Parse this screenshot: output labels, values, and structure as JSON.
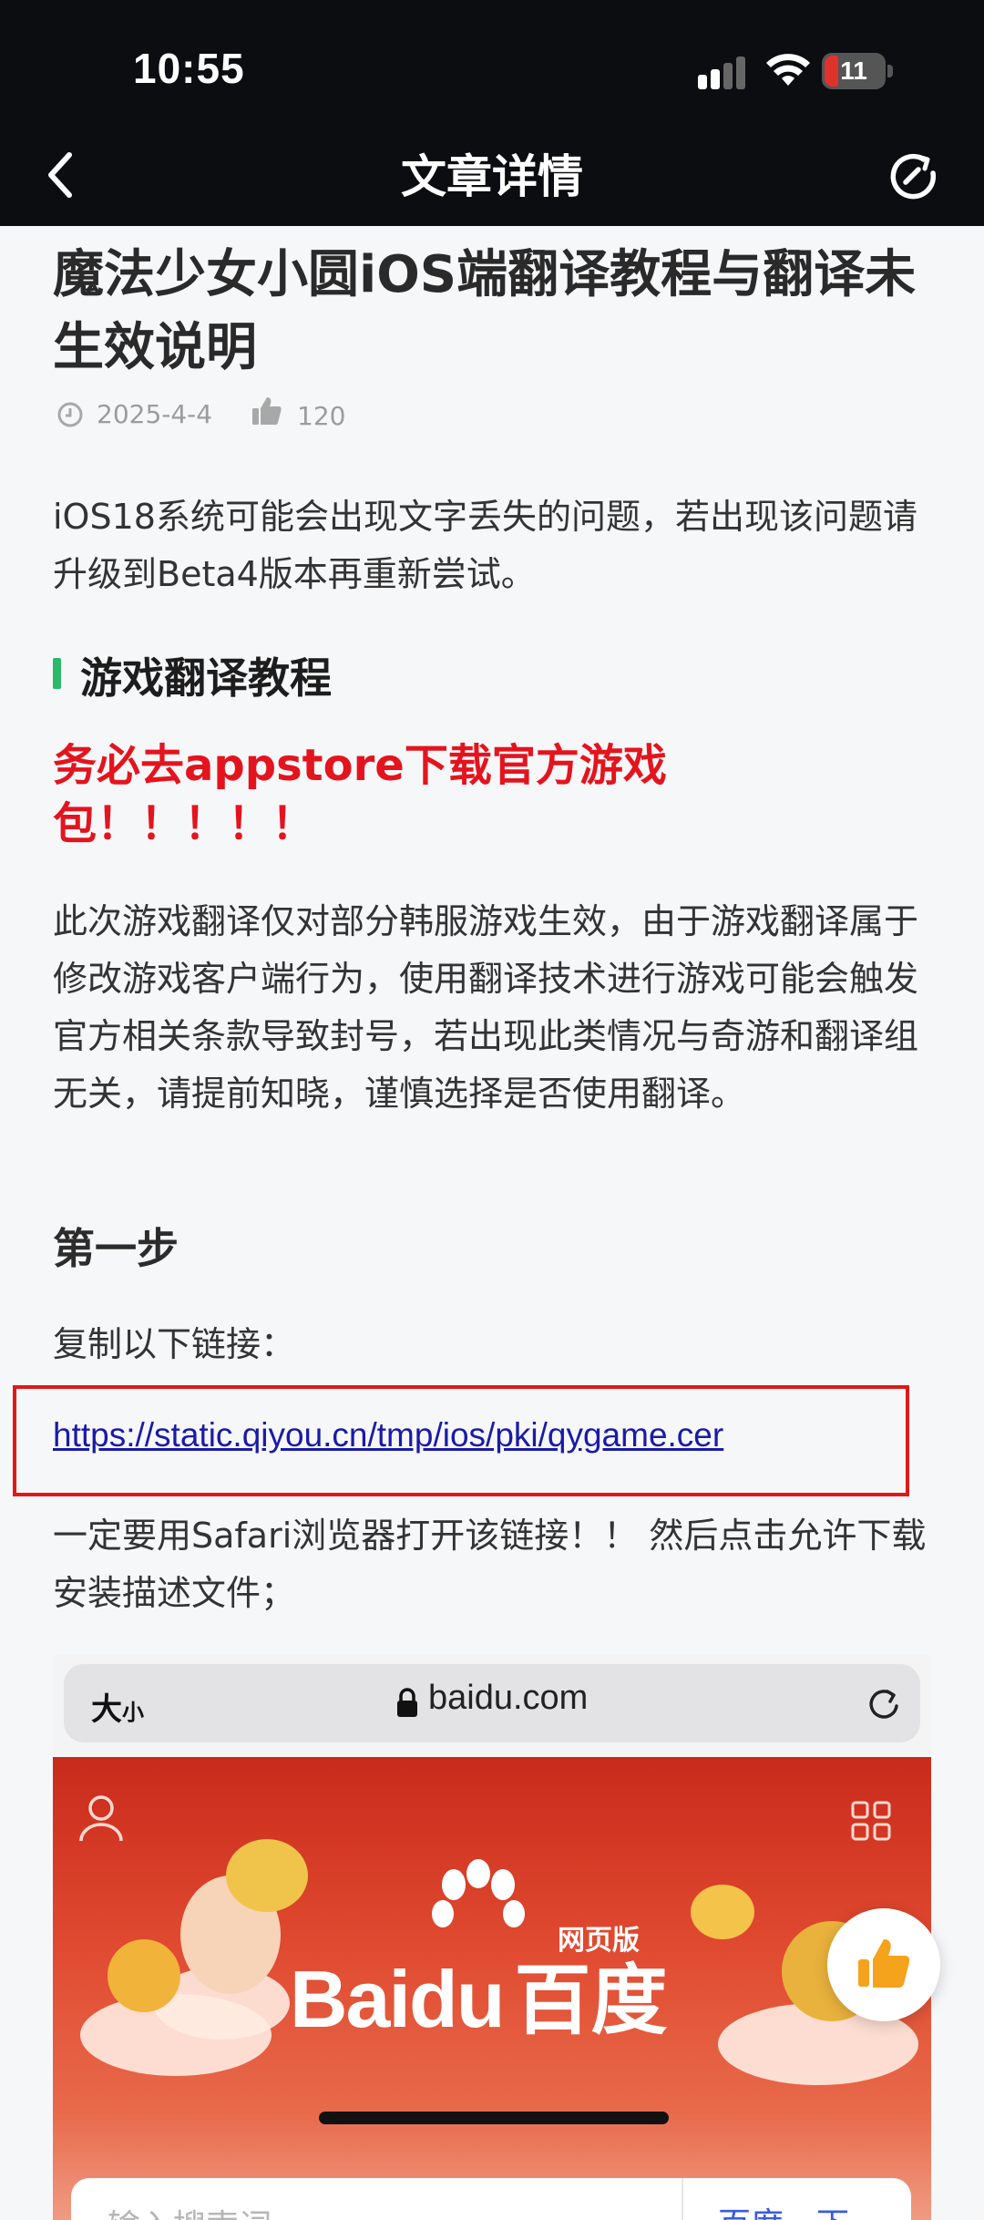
{
  "status_bar": {
    "time": "10:55",
    "battery": "11"
  },
  "nav": {
    "title": "文章详情"
  },
  "article": {
    "title": "魔法少女小圆iOS端翻译教程与翻译未生效说明",
    "date": "2025-4-4",
    "likes": "120",
    "intro": "iOS18系统可能会出现文字丢失的问题，若出现该问题请升级到Beta4版本再重新尝试。",
    "section_title": "游戏翻译教程",
    "warning": "务必去appstore下载官方游戏包！！！！！",
    "disclaimer": "此次游戏翻译仅对部分韩服游戏生效，由于游戏翻译属于修改游戏客户端行为，使用翻译技术进行游戏可能会触发官方相关条款导致封号，若出现此类情况与奇游和翻译组无关，请提前知晓，谨慎选择是否使用翻译。",
    "step1_title": "第一步",
    "step1_text": "复制以下链接：",
    "link": "https://static.qiyou.cn/tmp/ios/pki/qygame.cer",
    "step1_note": "一定要用Safari浏览器打开该链接！！ 然后点击允许下载安装描述文件；"
  },
  "embedded_screenshot": {
    "aa_label": "大",
    "aa_small": "小",
    "domain": "baidu.com",
    "logo_latin": "Bai",
    "logo_du": "du",
    "logo_cn": "百度",
    "logo_badge": "网页版",
    "search_placeholder": "输入搜索词",
    "search_button": "百度一下"
  },
  "colors": {
    "top_bar": "#0c0d10",
    "page_bg": "#f6f7f9",
    "warning_red": "#e4141e",
    "section_accent": "#2db86a",
    "link": "#1a1aa8",
    "highlight_box": "#e01818",
    "like_button": "#f5a21c"
  },
  "icons": {
    "back": "chevron-left-icon",
    "refresh": "refresh-icon",
    "date": "clock-icon",
    "likes": "thumb-up-icon",
    "fab": "thumb-up-icon"
  }
}
